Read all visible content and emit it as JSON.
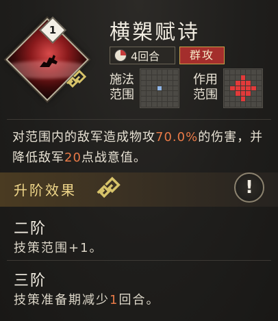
{
  "skill": {
    "level": "1",
    "name": "横槊赋诗",
    "turns": "4回合",
    "type_tag": "群攻",
    "cast_range_label_1": "施法",
    "cast_range_label_2": "范围",
    "effect_range_label_1": "作用",
    "effect_range_label_2": "范围"
  },
  "description": {
    "part1": "对范围内的敌军造成物攻",
    "percent": "70.0%",
    "part2": "的伤害，并降低敌军",
    "points": "20",
    "part3": "点战意值。"
  },
  "upgrade": {
    "title": "升阶效果",
    "info_label": "!",
    "tiers": [
      {
        "name": "二阶",
        "text": "技策范围+1。"
      },
      {
        "name": "三阶",
        "text_before": "技策准备期减少",
        "value": "1",
        "text_after": "回合。"
      }
    ]
  },
  "colors": {
    "highlight": "#e97a47",
    "tag_bg": "#a42e2c",
    "accent_gold": "#f0d78a"
  },
  "icons": {
    "turns": "pie-timer-icon",
    "ornament": "cloud-knot-icon",
    "info": "exclamation-icon"
  }
}
